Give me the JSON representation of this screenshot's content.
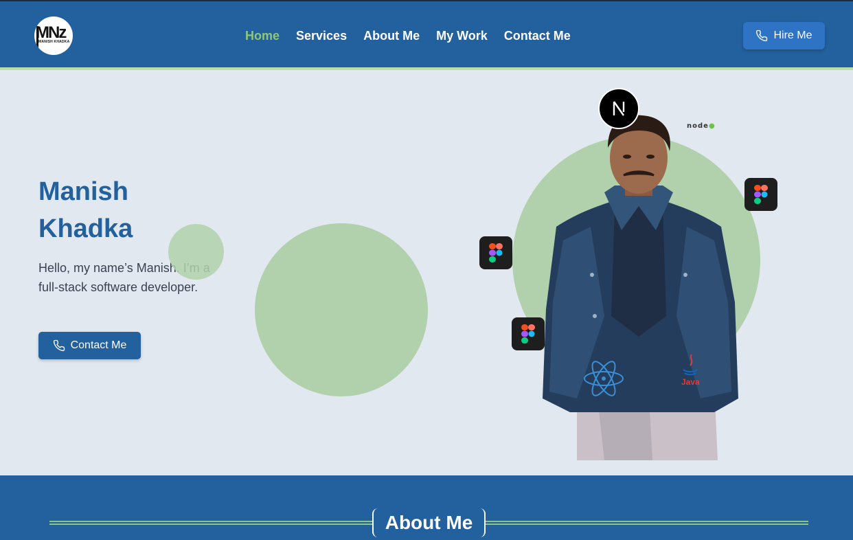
{
  "logo": {
    "mark": "MNz",
    "sub": "MANISH KHADKA"
  },
  "nav": {
    "links": [
      "Home",
      "Services",
      "About Me",
      "My Work",
      "Contact Me"
    ],
    "active": "Home",
    "hire_label": "Hire Me"
  },
  "hero": {
    "name": "Manish Khadka",
    "description": "Hello, my name’s Manish. I’m a full-stack software developer.",
    "contact_label": "Contact Me"
  },
  "tech_icons": {
    "next": "N",
    "node": "node",
    "java": "Java"
  },
  "about": {
    "title": "About Me"
  },
  "colors": {
    "primary": "#23609e",
    "accent": "#8fc77a",
    "hero_bg": "#e2e8f0",
    "circle": "#b0d1ab"
  }
}
